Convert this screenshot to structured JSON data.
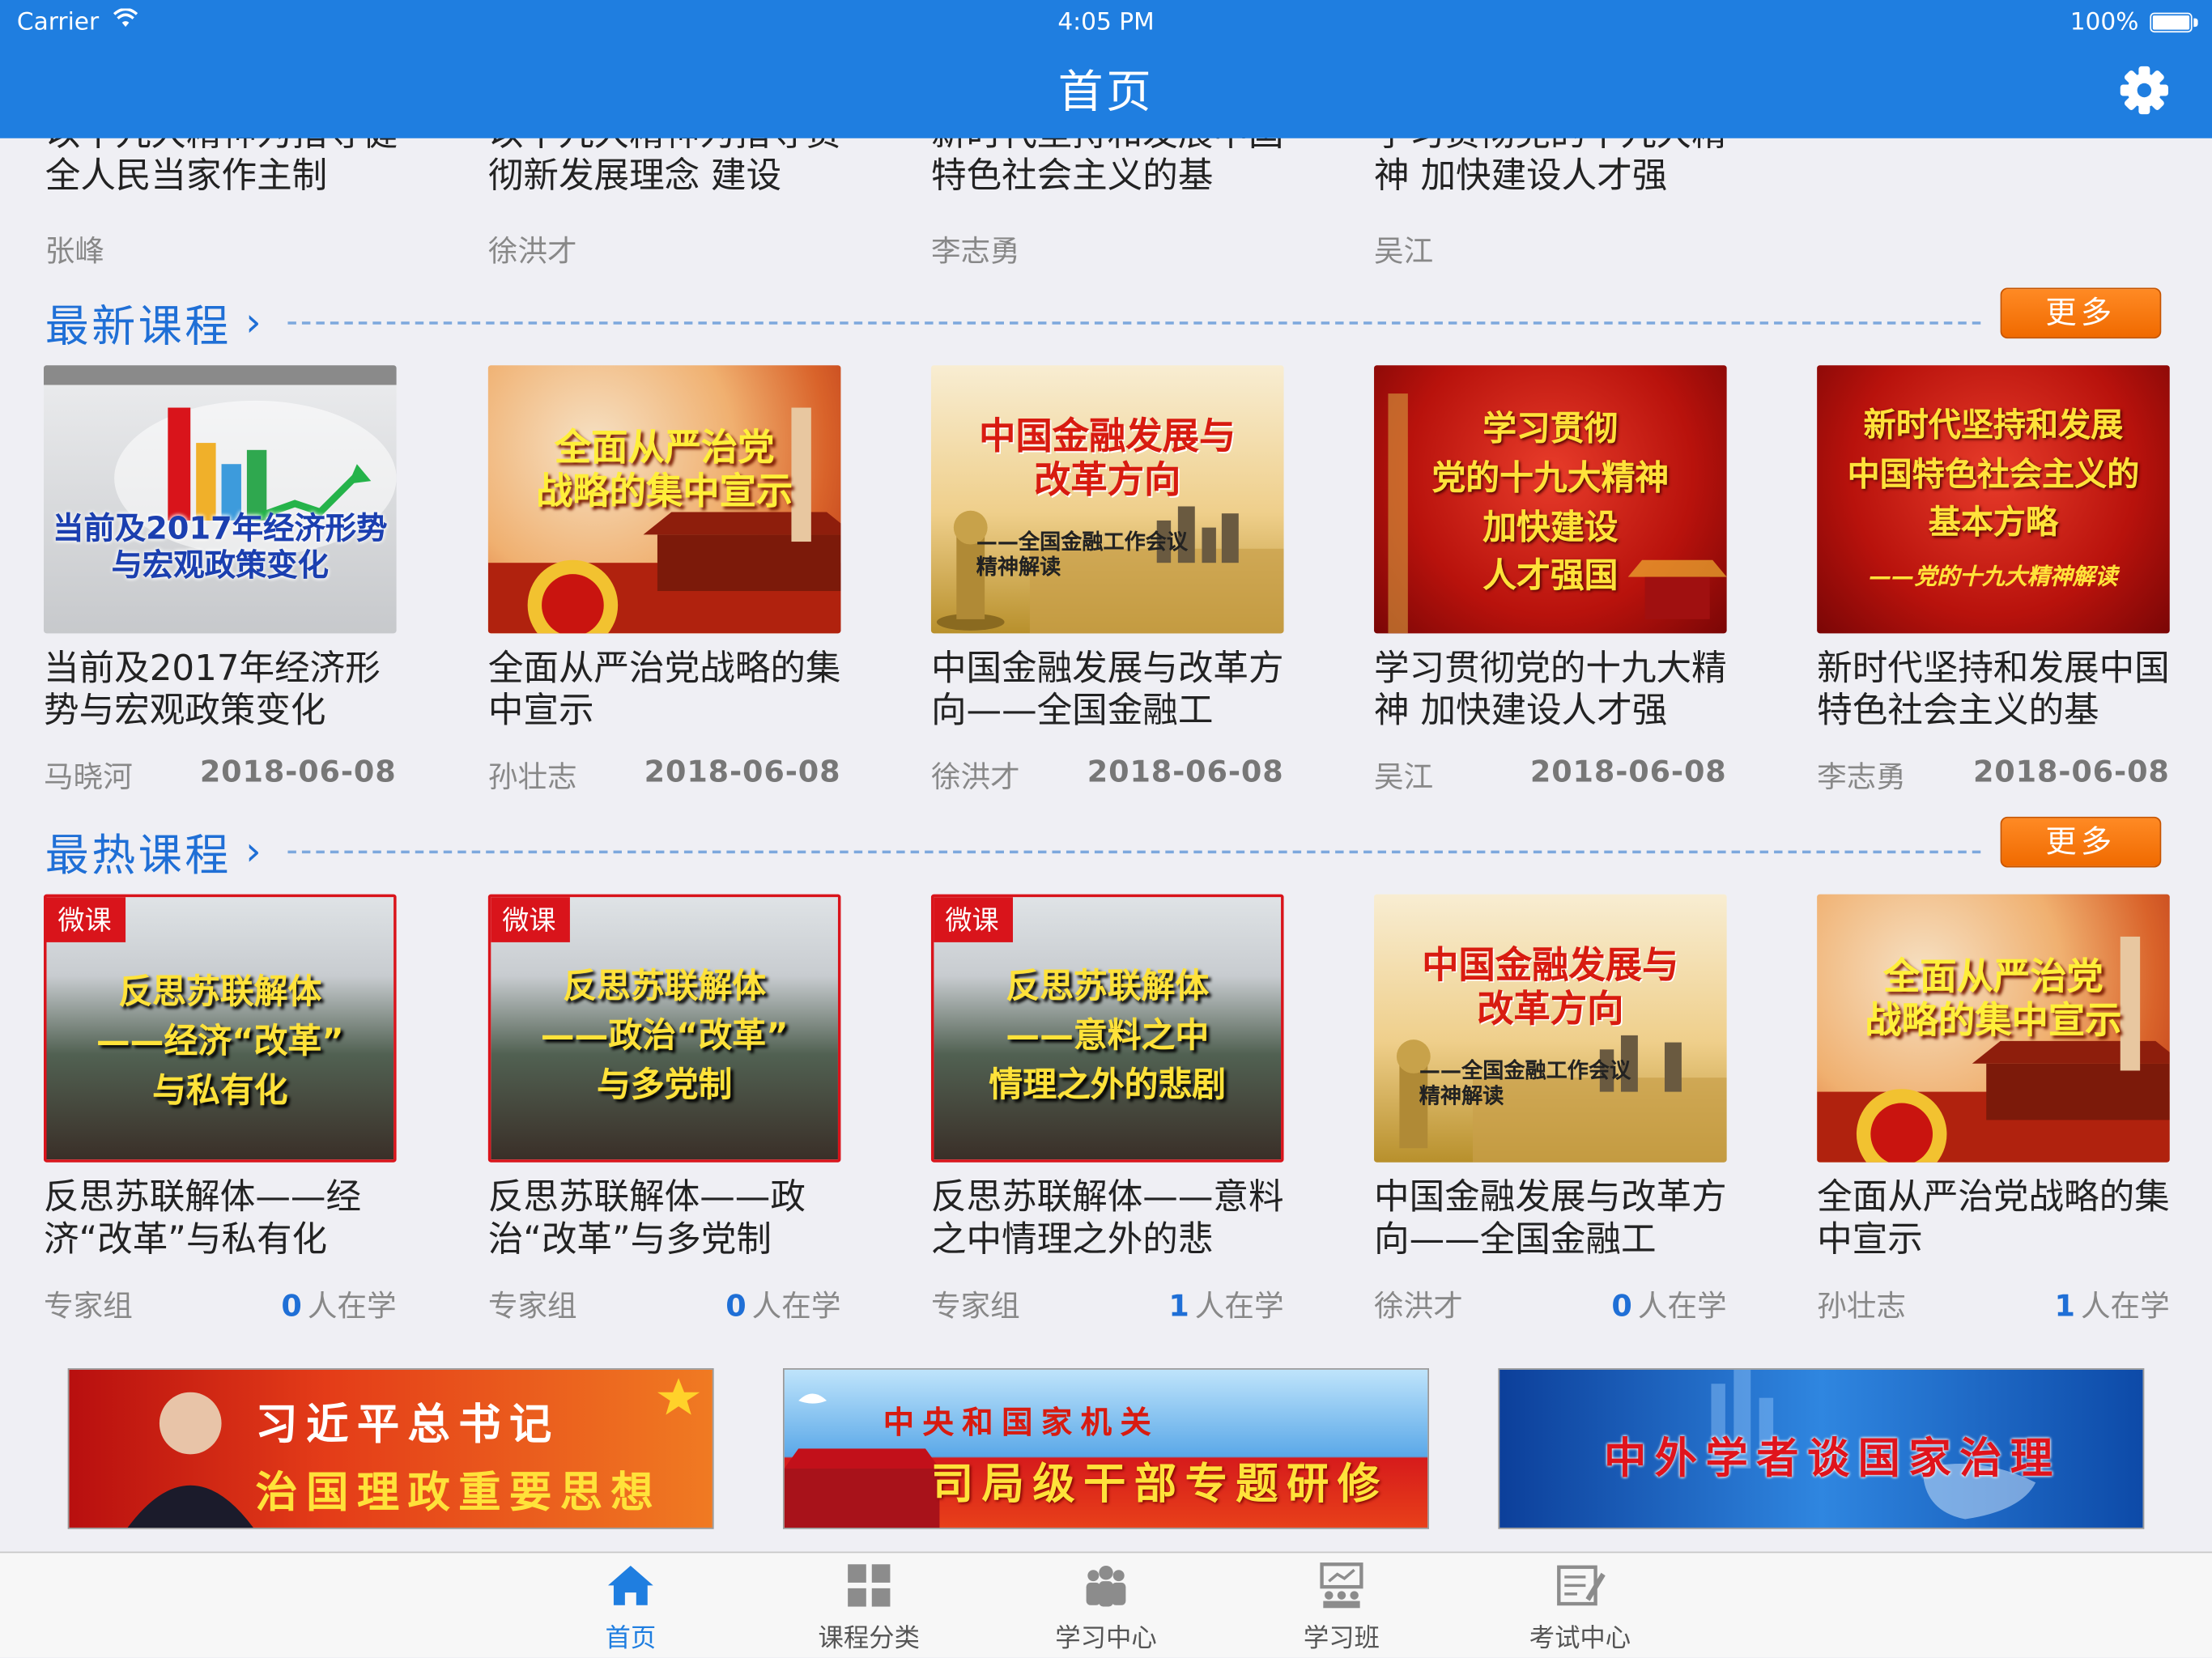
{
  "status_bar": {
    "carrier": "Carrier",
    "time": "4:05 PM",
    "battery": "100%"
  },
  "nav": {
    "title": "首页",
    "settings_icon": "gear-icon"
  },
  "top_partial": [
    {
      "title": "以十九大精神为指导健全人民当家作主制",
      "author": "张峰"
    },
    {
      "title": "以十九大精神为指导贯彻新发展理念 建设",
      "author": "徐洪才"
    },
    {
      "title": "新时代坚持和发展中国特色社会主义的基",
      "author": "李志勇"
    },
    {
      "title": "学习贯彻党的十九大精神 加快建设人才强",
      "author": "吴江"
    }
  ],
  "latest": {
    "heading": "最新课程",
    "more": "更多",
    "items": [
      {
        "thumb_caption": "当前及2017年经济形势\n与宏观政策变化",
        "title": "当前及2017年经济形势与宏观政策变化",
        "author": "马晓河",
        "date": "2018-06-08"
      },
      {
        "thumb_caption": "全面从严治党\n战略的集中宣示",
        "title": "全面从严治党战略的集中宣示",
        "author": "孙壮志",
        "date": "2018-06-08"
      },
      {
        "thumb_caption": "中国金融发展与\n改革方向",
        "thumb_sub": "——全国金融工作会议\n精神解读",
        "title": "中国金融发展与改革方向——全国金融工",
        "author": "徐洪才",
        "date": "2018-06-08"
      },
      {
        "thumb_caption": "学习贯彻\n党的十九大精神\n加快建设\n人才强国",
        "title": "学习贯彻党的十九大精神 加快建设人才强",
        "author": "吴江",
        "date": "2018-06-08"
      },
      {
        "thumb_caption": "新时代坚持和发展\n中国特色社会主义的\n基本方略",
        "thumb_sub": "——党的十九大精神解读",
        "title": "新时代坚持和发展中国特色社会主义的基",
        "author": "李志勇",
        "date": "2018-06-08"
      }
    ]
  },
  "hot": {
    "heading": "最热课程",
    "more": "更多",
    "badge": "微课",
    "learning_suffix": "人在学",
    "items": [
      {
        "thumb_caption": "反思苏联解体\n——经济“改革”\n与私有化",
        "title": "反思苏联解体——经济“改革”与私有化",
        "author": "专家组",
        "count": "0"
      },
      {
        "thumb_caption": "反思苏联解体\n——政治“改革”\n与多党制",
        "title": "反思苏联解体——政治“改革”与多党制",
        "author": "专家组",
        "count": "0"
      },
      {
        "thumb_caption": "反思苏联解体\n——意料之中\n情理之外的悲剧",
        "title": "反思苏联解体——意料之中情理之外的悲",
        "author": "专家组",
        "count": "1"
      },
      {
        "thumb_caption": "中国金融发展与\n改革方向",
        "thumb_sub": "——全国金融工作会议\n精神解读",
        "title": "中国金融发展与改革方向——全国金融工",
        "author": "徐洪才",
        "count": "0"
      },
      {
        "thumb_caption": "全面从严治党\n战略的集中宣示",
        "title": "全面从严治党战略的集中宣示",
        "author": "孙壮志",
        "count": "1"
      }
    ]
  },
  "banners": [
    {
      "line1": "习近平总书记",
      "line2": "治国理政重要思想"
    },
    {
      "line1": "中央和国家机关",
      "line2": "司局级干部专题研修"
    },
    {
      "line1": "中外学者谈国家治理"
    }
  ],
  "tabs": [
    {
      "label": "首页",
      "icon": "home-icon",
      "active": true
    },
    {
      "label": "课程分类",
      "icon": "grid-icon"
    },
    {
      "label": "学习中心",
      "icon": "people-icon"
    },
    {
      "label": "学习班",
      "icon": "classroom-icon"
    },
    {
      "label": "考试中心",
      "icon": "exam-icon"
    }
  ],
  "colors": {
    "brand_blue": "#1f7ee0",
    "accent_orange": "#f07a00",
    "badge_red": "#d9141b"
  }
}
